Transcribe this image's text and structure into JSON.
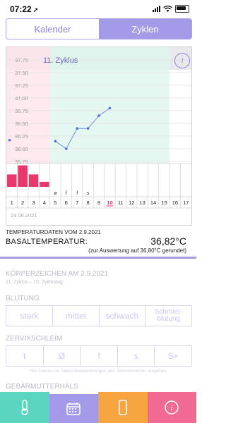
{
  "status": {
    "time": "07:22",
    "location_icon": "location-arrow-icon"
  },
  "segment": {
    "tab1": "Kalender",
    "tab2": "Zyklen",
    "active": "Zyklen"
  },
  "chart_data": {
    "type": "line",
    "title": "11. Zyklus",
    "y_ticks": [
      "37.75",
      "37.50",
      "37.25",
      "37.00",
      "36.75",
      "36.50",
      "36.25",
      "36.00",
      "35.75"
    ],
    "ylim": [
      35.75,
      37.75
    ],
    "days": [
      1,
      2,
      3,
      4,
      5,
      6,
      7,
      8,
      9,
      10,
      11,
      12,
      13,
      14,
      15,
      16,
      17
    ],
    "highlighted_day": 10,
    "temperature_points": [
      {
        "day": 0.8,
        "temp": 36.17
      },
      {
        "day": 5,
        "temp": 36.15
      },
      {
        "day": 6,
        "temp": 36.0
      },
      {
        "day": 7,
        "temp": 36.4
      },
      {
        "day": 8,
        "temp": 36.4
      },
      {
        "day": 9,
        "temp": 36.65
      },
      {
        "day": 10,
        "temp": 36.8
      }
    ],
    "bleeding_bars": [
      {
        "day": 1,
        "level": 0.55
      },
      {
        "day": 2,
        "level": 0.95
      },
      {
        "day": 3,
        "level": 0.55
      },
      {
        "day": 4,
        "level": 0.22
      }
    ],
    "mucus_labels": [
      {
        "day": 5,
        "label": "ø"
      },
      {
        "day": 6,
        "label": "f"
      },
      {
        "day": 7,
        "label": "f"
      },
      {
        "day": 8,
        "label": "s"
      }
    ],
    "phase_zones": {
      "menstruation_days": [
        1,
        4
      ],
      "fertile_days": [
        5,
        15
      ]
    },
    "date_label": "24.08.2021"
  },
  "temp": {
    "date_line": "TEMPERATURDATEN VOM 2.9.2021",
    "label": "BASALTEMPERATUR:",
    "value": "36,82°C",
    "note": "(zur Auswertung auf 36,80°C gerundet)"
  },
  "body_signs": {
    "title": "KÖRPERZEICHEN AM 2.9.2021",
    "subtitle": "11. Zyklus – 10. Zyklustag"
  },
  "bleeding": {
    "title": "BLUTUNG",
    "options": [
      "stark",
      "mittel",
      "schwach",
      "Schmier-\nblutung"
    ]
  },
  "mucus": {
    "title": "ZERVIXSCHLEIM",
    "options": [
      "t",
      "Ø",
      "f",
      "s",
      "S+"
    ],
    "hint": "Hier kannst Du Deine Beobachtungen des Zervixschleims angeben."
  },
  "cervix": {
    "title": "GEBÄRMUTTERHALS"
  },
  "tabbar": [
    "thermometer-icon",
    "calendar-icon",
    "phone-icon",
    "info-icon"
  ],
  "colors": {
    "accent": "#a39be8",
    "teal": "#5bd4c0",
    "orange": "#f7a541",
    "pink": "#f06a92",
    "bleed": "#e8386b"
  }
}
